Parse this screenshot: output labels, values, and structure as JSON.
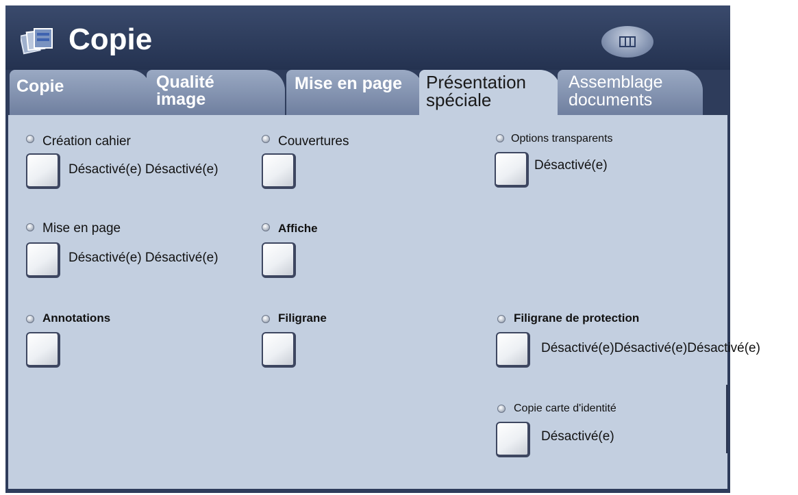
{
  "header": {
    "title": "Copie",
    "app_icon": "copy-icon",
    "home_icon": "grid-home-icon"
  },
  "tabs": [
    {
      "label": "Copie",
      "active": false
    },
    {
      "label_lines": [
        "Qualité",
        "image"
      ],
      "active": false
    },
    {
      "label": "Mise en page",
      "active": false
    },
    {
      "label_lines": [
        "Présentation",
        "spéciale"
      ],
      "active": true
    },
    {
      "label_lines": [
        "Assemblage",
        "documents"
      ],
      "active": false
    }
  ],
  "options": {
    "creation_cahier": {
      "label": "Création cahier",
      "status": "Désactivé(e) Désactivé(e)"
    },
    "couvertures": {
      "label": "Couvertures"
    },
    "options_transparents": {
      "label": "Options transparents",
      "status": "Désactivé(e)"
    },
    "mise_en_page": {
      "label": "Mise en page",
      "status": "Désactivé(e) Désactivé(e)"
    },
    "affiche": {
      "label": "Affiche"
    },
    "annotations": {
      "label": "Annotations"
    },
    "filigrane": {
      "label": "Filigrane"
    },
    "filigrane_protection": {
      "label": "Filigrane de protection",
      "status": "Désactivé(e)Désactivé(e)Désactivé(e)"
    },
    "copie_carte": {
      "label": "Copie carte d'identité",
      "status": "Désactivé(e)"
    }
  },
  "colors": {
    "header_bg": "#2e3c5b",
    "tab_inactive": "#8796b4",
    "panel_bg": "#c3cfe0"
  }
}
